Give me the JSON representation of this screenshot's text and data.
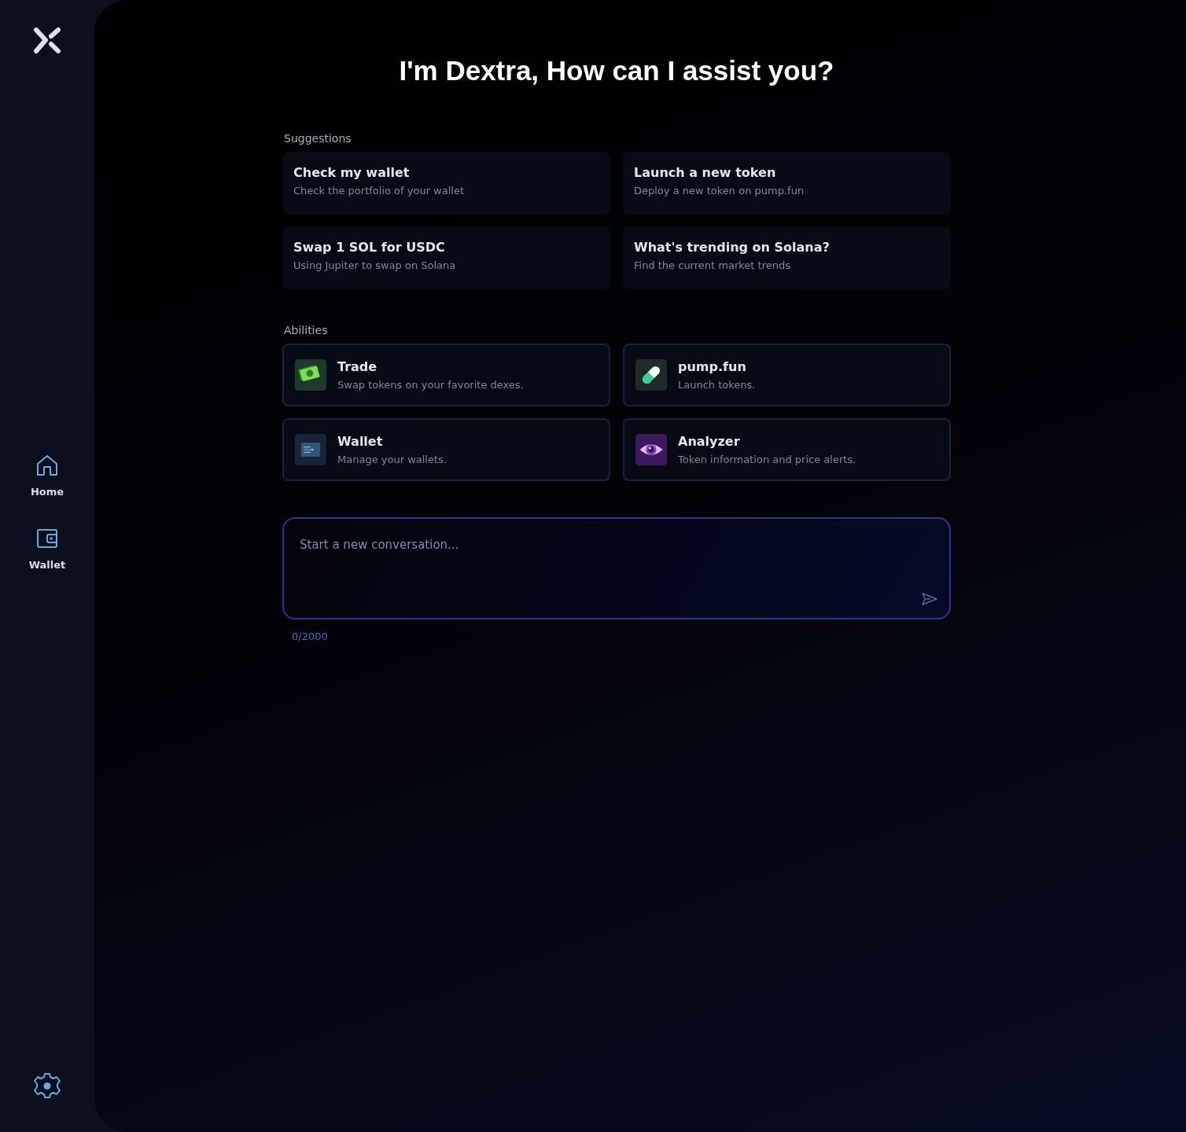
{
  "sidebar": {
    "nav": [
      {
        "kind": "home",
        "label": "Home"
      },
      {
        "kind": "wallet",
        "label": "Wallet"
      }
    ]
  },
  "title": "I'm Dextra, How can I assist you?",
  "suggestions": {
    "heading": "Suggestions",
    "items": [
      {
        "title": "Check my wallet",
        "subtitle": "Check the portfolio of your wallet"
      },
      {
        "title": "Launch a new token",
        "subtitle": "Deploy a new token on pump.fun"
      },
      {
        "title": "Swap 1 SOL for USDC",
        "subtitle": "Using Jupiter to swap on Solana"
      },
      {
        "title": "What's trending on Solana?",
        "subtitle": "Find the current market trends"
      }
    ]
  },
  "abilities": {
    "heading": "Abilities",
    "items": [
      {
        "kind": "cash",
        "title": "Trade",
        "subtitle": "Swap tokens on your favorite dexes."
      },
      {
        "kind": "pill",
        "title": "pump.fun",
        "subtitle": "Launch tokens."
      },
      {
        "kind": "wallet",
        "title": "Wallet",
        "subtitle": "Manage your wallets."
      },
      {
        "kind": "eye",
        "title": "Analyzer",
        "subtitle": "Token information and price alerts."
      }
    ]
  },
  "composer": {
    "placeholder": "Start a new conversation...",
    "counter": "0/2000"
  }
}
